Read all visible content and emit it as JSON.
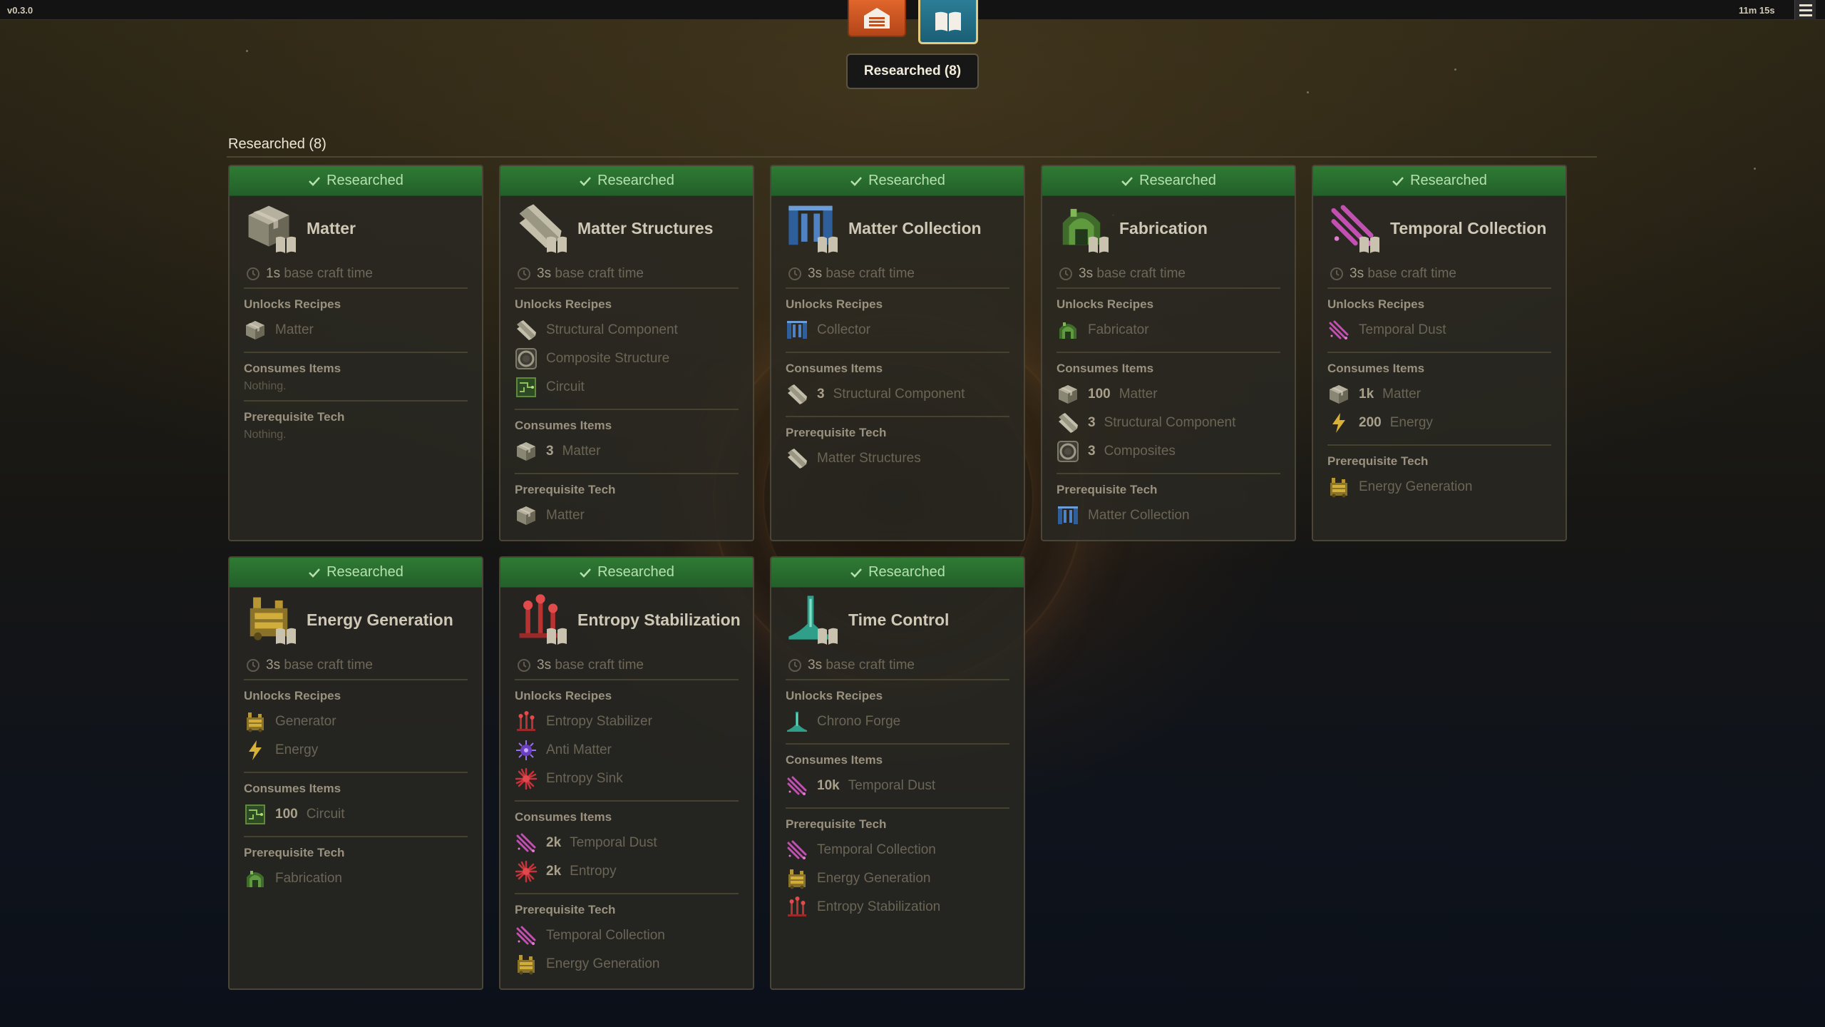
{
  "app": {
    "version": "v0.3.0",
    "timer": "11m 15s"
  },
  "nav": {
    "factory_icon": "factory-icon",
    "research_icon": "book-icon"
  },
  "filter": {
    "label": "Researched (8)"
  },
  "section": {
    "title": "Researched (8)"
  },
  "colors": {
    "researched": "#2f7a33",
    "accent_gold": "#e4c980",
    "factory": "#e0662c",
    "research": "#2b7d96"
  },
  "labels": {
    "unlocks": "Unlocks Recipes",
    "consumes": "Consumes Items",
    "prereq": "Prerequisite Tech",
    "nothing": "Nothing."
  },
  "cards": [
    {
      "status": "Researched",
      "name": "Matter",
      "icon": "matter-icon",
      "craft_time": "1s",
      "craft_suffix": " base craft time",
      "unlocks": [
        {
          "name": "Matter",
          "icon": "matter-icon"
        }
      ],
      "consumes": [],
      "prereqs": []
    },
    {
      "status": "Researched",
      "name": "Matter Structures",
      "icon": "structural-component-icon",
      "craft_time": "3s",
      "craft_suffix": " base craft time",
      "unlocks": [
        {
          "name": "Structural Component",
          "icon": "structural-component-icon"
        },
        {
          "name": "Composite Structure",
          "icon": "composite-icon"
        },
        {
          "name": "Circuit",
          "icon": "circuit-icon"
        }
      ],
      "consumes": [
        {
          "qty": "3",
          "name": "Matter",
          "icon": "matter-icon"
        }
      ],
      "prereqs": [
        {
          "name": "Matter",
          "icon": "matter-icon"
        }
      ]
    },
    {
      "status": "Researched",
      "name": "Matter Collection",
      "icon": "collector-icon",
      "craft_time": "3s",
      "craft_suffix": " base craft time",
      "unlocks": [
        {
          "name": "Collector",
          "icon": "collector-icon"
        }
      ],
      "consumes": [
        {
          "qty": "3",
          "name": "Structural Component",
          "icon": "structural-component-icon"
        }
      ],
      "prereqs": [
        {
          "name": "Matter Structures",
          "icon": "structural-component-icon"
        }
      ]
    },
    {
      "status": "Researched",
      "name": "Fabrication",
      "icon": "fabricator-icon",
      "craft_time": "3s",
      "craft_suffix": " base craft time",
      "unlocks": [
        {
          "name": "Fabricator",
          "icon": "fabricator-icon"
        }
      ],
      "consumes": [
        {
          "qty": "100",
          "name": "Matter",
          "icon": "matter-icon"
        },
        {
          "qty": "3",
          "name": "Structural Component",
          "icon": "structural-component-icon"
        },
        {
          "qty": "3",
          "name": "Composites",
          "icon": "composite-icon"
        }
      ],
      "prereqs": [
        {
          "name": "Matter Collection",
          "icon": "collector-icon"
        }
      ]
    },
    {
      "status": "Researched",
      "name": "Temporal Collection",
      "icon": "temporal-dust-icon",
      "craft_time": "3s",
      "craft_suffix": " base craft time",
      "unlocks": [
        {
          "name": "Temporal Dust",
          "icon": "temporal-dust-icon"
        }
      ],
      "consumes": [
        {
          "qty": "1k",
          "name": "Matter",
          "icon": "matter-icon"
        },
        {
          "qty": "200",
          "name": "Energy",
          "icon": "energy-icon"
        }
      ],
      "prereqs": [
        {
          "name": "Energy Generation",
          "icon": "generator-icon"
        }
      ]
    },
    {
      "status": "Researched",
      "name": "Energy Generation",
      "icon": "generator-icon",
      "craft_time": "3s",
      "craft_suffix": " base craft time",
      "unlocks": [
        {
          "name": "Generator",
          "icon": "generator-icon"
        },
        {
          "name": "Energy",
          "icon": "energy-icon"
        }
      ],
      "consumes": [
        {
          "qty": "100",
          "name": "Circuit",
          "icon": "circuit-icon"
        }
      ],
      "prereqs": [
        {
          "name": "Fabrication",
          "icon": "fabricator-icon"
        }
      ]
    },
    {
      "status": "Researched",
      "name": "Entropy Stabilization",
      "icon": "entropy-stabilizer-icon",
      "craft_time": "3s",
      "craft_suffix": " base craft time",
      "unlocks": [
        {
          "name": "Entropy Stabilizer",
          "icon": "entropy-stabilizer-icon"
        },
        {
          "name": "Anti Matter",
          "icon": "anti-matter-icon"
        },
        {
          "name": "Entropy Sink",
          "icon": "entropy-icon"
        }
      ],
      "consumes": [
        {
          "qty": "2k",
          "name": "Temporal Dust",
          "icon": "temporal-dust-icon"
        },
        {
          "qty": "2k",
          "name": "Entropy",
          "icon": "entropy-icon"
        }
      ],
      "prereqs": [
        {
          "name": "Temporal Collection",
          "icon": "temporal-dust-icon"
        },
        {
          "name": "Energy Generation",
          "icon": "generator-icon"
        }
      ]
    },
    {
      "status": "Researched",
      "name": "Time Control",
      "icon": "chrono-forge-icon",
      "craft_time": "3s",
      "craft_suffix": " base craft time",
      "unlocks": [
        {
          "name": "Chrono Forge",
          "icon": "chrono-forge-icon"
        }
      ],
      "consumes": [
        {
          "qty": "10k",
          "name": "Temporal Dust",
          "icon": "temporal-dust-icon"
        }
      ],
      "prereqs": [
        {
          "name": "Temporal Collection",
          "icon": "temporal-dust-icon"
        },
        {
          "name": "Energy Generation",
          "icon": "generator-icon"
        },
        {
          "name": "Entropy Stabilization",
          "icon": "entropy-stabilizer-icon"
        }
      ]
    }
  ]
}
